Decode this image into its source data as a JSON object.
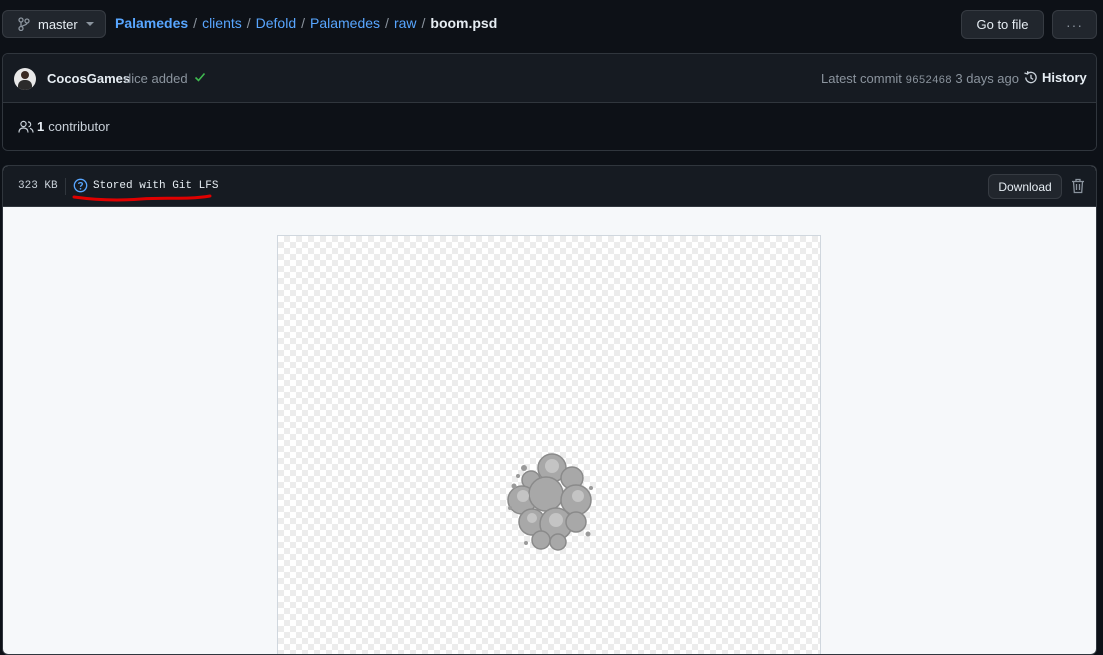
{
  "branch": {
    "label": "master"
  },
  "breadcrumb": {
    "repo": "Palamedes",
    "parts": [
      "clients",
      "Defold",
      "Palamedes",
      "raw"
    ],
    "file": "boom.psd"
  },
  "toolbar": {
    "go_to_file": "Go to file",
    "more": "···"
  },
  "commit": {
    "author": "CocosGames",
    "message": "dice added",
    "latest_label": "Latest commit",
    "sha": "9652468",
    "time": "3 days ago",
    "history_label": "History"
  },
  "contributors": {
    "count": "1",
    "label": "contributor"
  },
  "file": {
    "size": "323 KB",
    "lfs_label": "Stored with Git LFS",
    "download_label": "Download"
  },
  "colors": {
    "link": "#58a6ff",
    "success": "#3fb950",
    "annotation": "#e00000",
    "background": "#0d1117"
  }
}
